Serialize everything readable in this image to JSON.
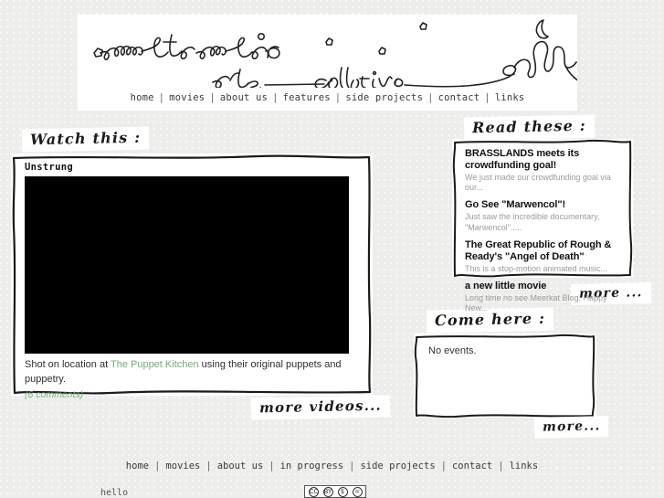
{
  "site": {
    "logo_line1": "meerkat media",
    "logo_line2": "arts collective"
  },
  "header_nav": {
    "items": [
      {
        "label": "home"
      },
      {
        "label": "movies"
      },
      {
        "label": "about us"
      },
      {
        "label": "features"
      },
      {
        "label": "side projects"
      },
      {
        "label": "contact"
      },
      {
        "label": "links"
      }
    ],
    "separator": "|"
  },
  "watch": {
    "heading": "Watch this :",
    "video_title": "Unstrung",
    "caption_before": "Shot on location at ",
    "caption_link": "The Puppet Kitchen",
    "caption_after": " using their original puppets and puppetry.",
    "comments_label": "(6 comments)",
    "more_label": "more videos..."
  },
  "blog": {
    "heading": "Read these :",
    "more_label": "more ...",
    "posts": [
      {
        "title": "BRASSLANDS meets its crowdfunding goal!",
        "excerpt": "We just made our crowdfunding goal via our..."
      },
      {
        "title": "Go See \"Marwencol\"!",
        "excerpt": "Just saw the incredible documentary, \"Marwencol\"....."
      },
      {
        "title": "The Great Republic of Rough & Ready's \"Angel of Death\"",
        "excerpt": "This is a stop-motion animated music..."
      },
      {
        "title": "a new little movie",
        "excerpt": "Long time no see Meerkat Blog. Happy New..."
      }
    ]
  },
  "events": {
    "heading": "Come here :",
    "empty_text": "No events.",
    "more_label": "more..."
  },
  "footer_nav": {
    "items": [
      {
        "label": "home"
      },
      {
        "label": "movies"
      },
      {
        "label": "about us"
      },
      {
        "label": "in progress"
      },
      {
        "label": "side projects"
      },
      {
        "label": "contact"
      },
      {
        "label": "links"
      }
    ],
    "separator": "|"
  },
  "footer": {
    "credit": "hello",
    "cc_glyphs": [
      "CC",
      "BY",
      "$",
      "="
    ]
  },
  "colors": {
    "page_background": "#ededec",
    "panel_background": "#ffffff",
    "ink": "#1a1a1a",
    "link_green": "#76a878",
    "muted_text": "#9a9a9a"
  }
}
